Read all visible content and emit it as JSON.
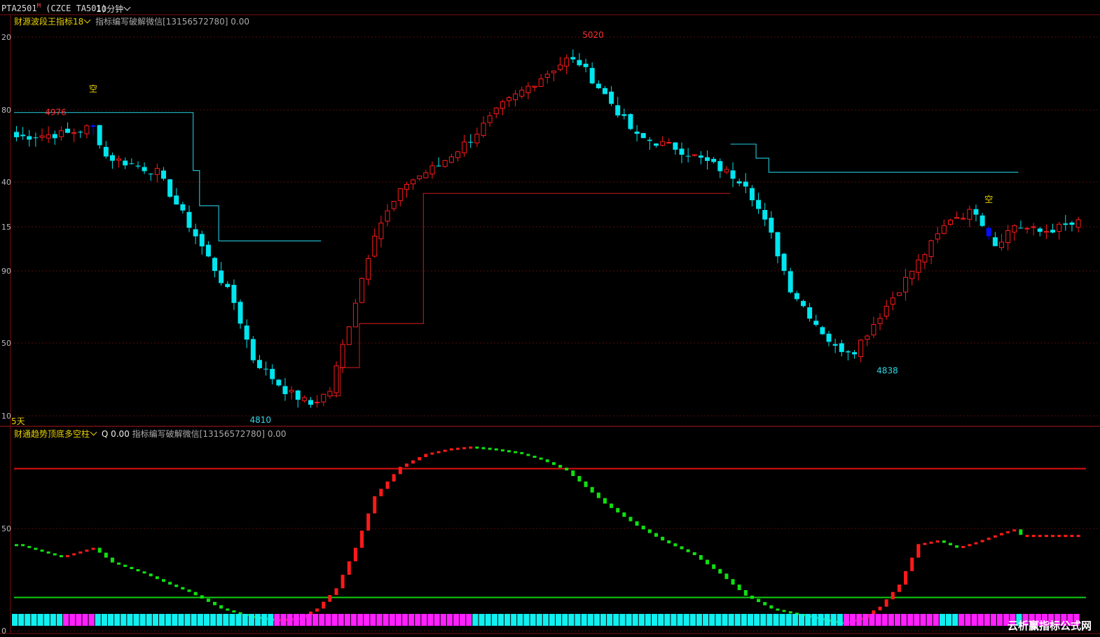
{
  "header": {
    "symbol": "PTA2501",
    "symbol_mark": "M",
    "symbol_code": "(CZCE TA501)",
    "period": "10分钟"
  },
  "main_panel": {
    "indicator_name": "财源波段王指标18",
    "indicator_note": "指标编写破解微信[13156572780] 0.00",
    "days_label": "5天",
    "y_tick_labels": [
      "20",
      "80",
      "40",
      "15",
      "90",
      "50",
      "10"
    ],
    "high_labels": [
      {
        "text": "4976"
      },
      {
        "text": "5020"
      }
    ],
    "low_labels": [
      {
        "text": "4810"
      },
      {
        "text": "4838"
      }
    ],
    "signal_labels": [
      {
        "text": "空"
      },
      {
        "text": "空"
      }
    ]
  },
  "sub_panel": {
    "indicator_name": "财通趋势顶底多空柱",
    "indicator_value": "Q 0.00",
    "indicator_note": "指标编写破解微信[13156572780] 0.00",
    "y_tick_labels": [
      "50",
      "0"
    ],
    "upper_line_level": 85,
    "lower_line_level": 15
  },
  "watermark": "云析赢指标公式网",
  "colors": {
    "background": "#000000",
    "up_candle": "#ff1a1a",
    "down_candle": "#00e5ee",
    "signal_bar": "#0010ff",
    "stop_line_short": "#1fb8c8",
    "stop_line_long": "#b01818",
    "osc_up": "#ff1a1a",
    "osc_down": "#10e010",
    "state_bull": "#ff20ff",
    "state_bear": "#10f0f0",
    "ref_high": "#e01010",
    "ref_low": "#10d010"
  },
  "chart_data": {
    "type": "candlestick",
    "ylim": [
      4806,
      5032
    ],
    "anchors": [
      [
        0,
        4966
      ],
      [
        8,
        4968
      ],
      [
        12,
        4972
      ],
      [
        14,
        4955
      ],
      [
        22,
        4946
      ],
      [
        28,
        4910
      ],
      [
        34,
        4872
      ],
      [
        37,
        4840
      ],
      [
        42,
        4822
      ],
      [
        46,
        4814
      ],
      [
        49,
        4822
      ],
      [
        52,
        4860
      ],
      [
        56,
        4912
      ],
      [
        61,
        4940
      ],
      [
        66,
        4950
      ],
      [
        71,
        4965
      ],
      [
        76,
        4984
      ],
      [
        82,
        5000
      ],
      [
        86,
        5010
      ],
      [
        88,
        5008
      ],
      [
        92,
        4990
      ],
      [
        97,
        4966
      ],
      [
        103,
        4960
      ],
      [
        109,
        4950
      ],
      [
        114,
        4940
      ],
      [
        118,
        4910
      ],
      [
        121,
        4880
      ],
      [
        125,
        4860
      ],
      [
        128,
        4846
      ],
      [
        131,
        4845
      ],
      [
        136,
        4870
      ],
      [
        140,
        4890
      ],
      [
        146,
        4920
      ],
      [
        150,
        4924
      ],
      [
        153,
        4905
      ],
      [
        156,
        4916
      ],
      [
        160,
        4912
      ],
      [
        166,
        4917
      ]
    ],
    "signal_candles": [
      12,
      152
    ],
    "stop_line_short": [
      [
        0,
        4980
      ],
      [
        28,
        4980
      ],
      [
        28,
        4947
      ],
      [
        29,
        4947
      ],
      [
        29,
        4927
      ],
      [
        32,
        4927
      ],
      [
        32,
        4907
      ],
      [
        48,
        4907
      ]
    ],
    "stop_line_short_2": [
      [
        112,
        4962
      ],
      [
        116,
        4962
      ],
      [
        116,
        4954
      ],
      [
        118,
        4954
      ],
      [
        118,
        4946
      ],
      [
        157,
        4946
      ]
    ],
    "stop_line_long": [
      [
        49,
        4819
      ],
      [
        51,
        4819
      ],
      [
        51,
        4835
      ],
      [
        54,
        4835
      ],
      [
        54,
        4860
      ],
      [
        64,
        4860
      ],
      [
        64,
        4934
      ],
      [
        112,
        4934
      ]
    ],
    "osc_anchors": [
      [
        0,
        44
      ],
      [
        7,
        37
      ],
      [
        10,
        40
      ],
      [
        12,
        42
      ],
      [
        15,
        34
      ],
      [
        20,
        28
      ],
      [
        24,
        22
      ],
      [
        27,
        18
      ],
      [
        32,
        9
      ],
      [
        36,
        5
      ],
      [
        40,
        3
      ],
      [
        44,
        4
      ],
      [
        47,
        9
      ],
      [
        50,
        20
      ],
      [
        53,
        42
      ],
      [
        56,
        70
      ],
      [
        60,
        86
      ],
      [
        64,
        93
      ],
      [
        68,
        96
      ],
      [
        71,
        97
      ],
      [
        74,
        96
      ],
      [
        78,
        94
      ],
      [
        82,
        90
      ],
      [
        86,
        84
      ],
      [
        92,
        66
      ],
      [
        97,
        54
      ],
      [
        101,
        46
      ],
      [
        106,
        38
      ],
      [
        110,
        28
      ],
      [
        114,
        16
      ],
      [
        118,
        9
      ],
      [
        122,
        6
      ],
      [
        126,
        3
      ],
      [
        129,
        1
      ],
      [
        132,
        4
      ],
      [
        135,
        10
      ],
      [
        138,
        22
      ],
      [
        141,
        44
      ],
      [
        144,
        46
      ],
      [
        147,
        42
      ],
      [
        150,
        45
      ],
      [
        154,
        50
      ],
      [
        156,
        52
      ],
      [
        157,
        49
      ]
    ],
    "ref_high_level": 85,
    "ref_low_level": 15
  }
}
